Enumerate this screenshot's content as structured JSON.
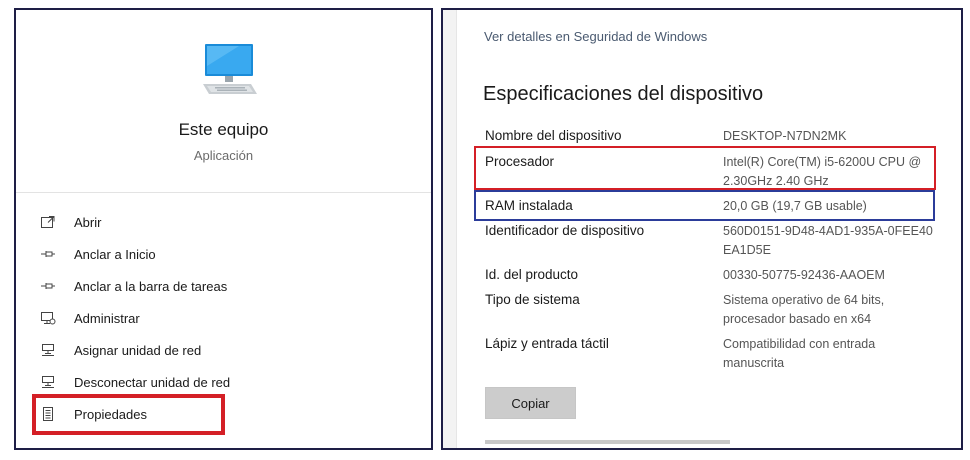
{
  "left": {
    "title": "Este equipo",
    "subtitle": "Aplicación",
    "menu_items": [
      {
        "label": "Abrir",
        "icon": "open-icon"
      },
      {
        "label": "Anclar a Inicio",
        "icon": "pin-icon"
      },
      {
        "label": "Anclar a la barra de tareas",
        "icon": "pin-icon"
      },
      {
        "label": "Administrar",
        "icon": "manage-icon"
      },
      {
        "label": "Asignar unidad de red",
        "icon": "network-drive-icon"
      },
      {
        "label": "Desconectar unidad de red",
        "icon": "network-drive-icon"
      },
      {
        "label": "Propiedades",
        "icon": "properties-icon"
      }
    ]
  },
  "right": {
    "security_link": "Ver detalles en Seguridad de Windows",
    "specs_title": "Especificaciones del dispositivo",
    "specs": [
      {
        "label": "Nombre del dispositivo",
        "value": "DESKTOP-N7DN2MK"
      },
      {
        "label": "Procesador",
        "value": "Intel(R) Core(TM) i5-6200U CPU @ 2.30GHz   2.40 GHz"
      },
      {
        "label": "RAM instalada",
        "value": "20,0 GB (19,7 GB usable)"
      },
      {
        "label": "Identificador de dispositivo",
        "value": "560D0151-9D48-4AD1-935A-0FEE40EA1D5E"
      },
      {
        "label": "Id. del producto",
        "value": "00330-50775-92436-AAOEM"
      },
      {
        "label": "Tipo de sistema",
        "value": "Sistema operativo de 64 bits, procesador basado en x64"
      },
      {
        "label": "Lápiz y entrada táctil",
        "value": "Compatibilidad con entrada manuscrita"
      }
    ],
    "copy_button": "Copiar"
  },
  "colors": {
    "highlight_red": "#d41f26",
    "highlight_blue": "#2b3c9a",
    "panel_border": "#1e1e46"
  }
}
